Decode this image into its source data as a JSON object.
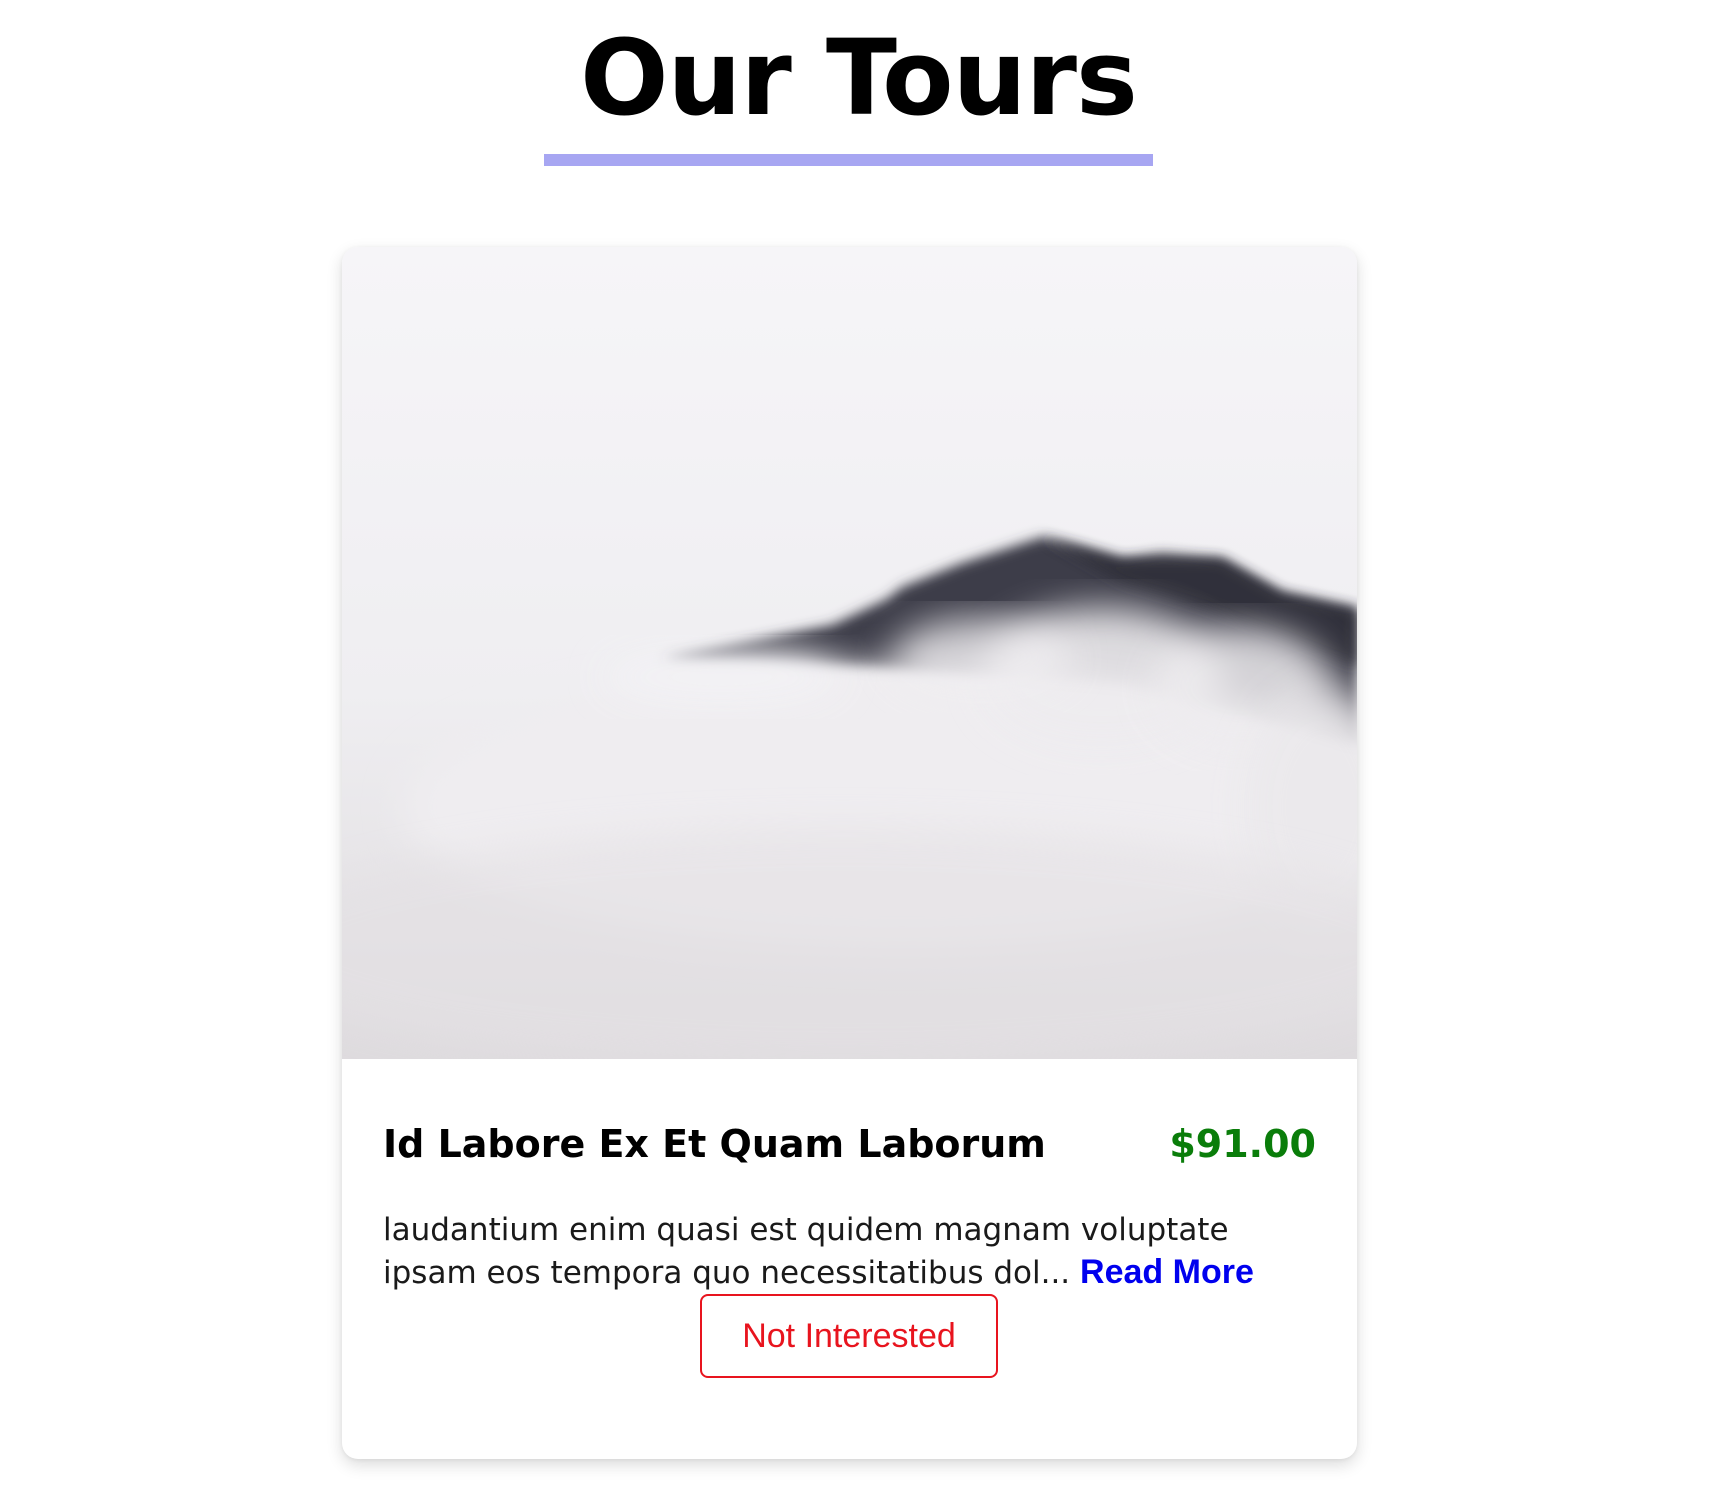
{
  "header": {
    "title": "Our Tours",
    "underline_color": "#a7a6f2"
  },
  "tours": [
    {
      "image": "misty mountain peak",
      "name": "Id Labore Ex Et Quam Laborum",
      "price": "$91.00",
      "price_color": "#0a7d0a",
      "info": "laudantium enim quasi est quidem magnam voluptate ipsam eos tempora quo necessitatibus dol...",
      "read_more_label": "Read More",
      "read_more_color": "#0000ee",
      "not_interested_label": "Not Interested",
      "not_interested_color": "#e8141e"
    }
  ]
}
